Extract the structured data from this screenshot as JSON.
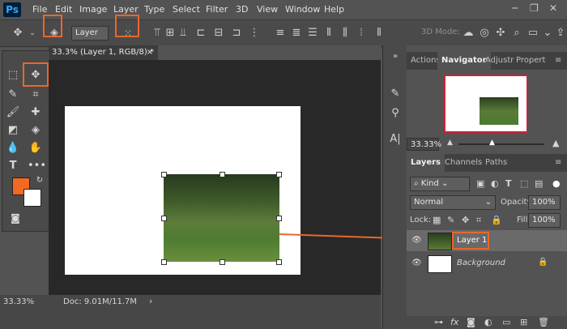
{
  "menu": {
    "logo": "Ps",
    "items": [
      "File",
      "Edit",
      "Image",
      "Layer",
      "Type",
      "Select",
      "Filter",
      "3D",
      "View",
      "Window",
      "Help"
    ]
  },
  "window_controls": {
    "minimize": "─",
    "restore": "❐",
    "close": "✕"
  },
  "options": {
    "auto_select_value": "Layer",
    "mode3d_label": "3D Mode:"
  },
  "document": {
    "tab_title": "33.3% (Layer 1, RGB/8) *",
    "tab_close": "×"
  },
  "panels": {
    "top_tabs": [
      "Actions",
      "Navigator",
      "Adjustr",
      "Propert"
    ],
    "active_top_tab": "Navigator",
    "nav_zoom": "33.33%",
    "layer_tabs": [
      "Layers",
      "Channels",
      "Paths"
    ],
    "kind_filter": "Kind",
    "blend_mode": "Normal",
    "opacity_label": "Opacity:",
    "opacity_value": "100%",
    "lock_label": "Lock:",
    "fill_label": "Fill:",
    "fill_value": "100%"
  },
  "layers": [
    {
      "name": "Layer 1",
      "selected": true
    },
    {
      "name": "Background",
      "selected": false,
      "locked": true
    }
  ],
  "status": {
    "zoom": "33.33%",
    "doc": "Doc: 9.01M/11.7M"
  },
  "colors": {
    "accent": "#e8672c",
    "foreground": "#f26a22",
    "background": "#ffffff"
  }
}
